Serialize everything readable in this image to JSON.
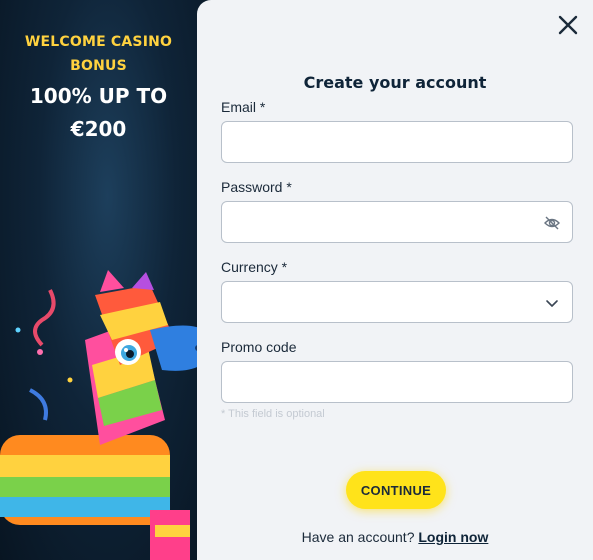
{
  "promo": {
    "line1": "WELCOME CASINO BONUS",
    "line2": "100% UP TO €200"
  },
  "form": {
    "title": "Create your account",
    "email_label": "Email *",
    "password_label": "Password *",
    "currency_label": "Currency *",
    "promo_label": "Promo code",
    "promo_hint": "* This field is optional",
    "continue_label": "CONTINUE",
    "have_account_text": "Have an account?",
    "login_link": "Login now"
  },
  "icons": {
    "close": "close-icon",
    "password_toggle": "eye-off-icon",
    "currency_dropdown": "chevron-down-icon"
  },
  "colors": {
    "accent": "#ffe31a",
    "promo_yellow": "#ffd23f",
    "panel_bg": "#f1f3f6",
    "dark_text": "#0f2438"
  }
}
